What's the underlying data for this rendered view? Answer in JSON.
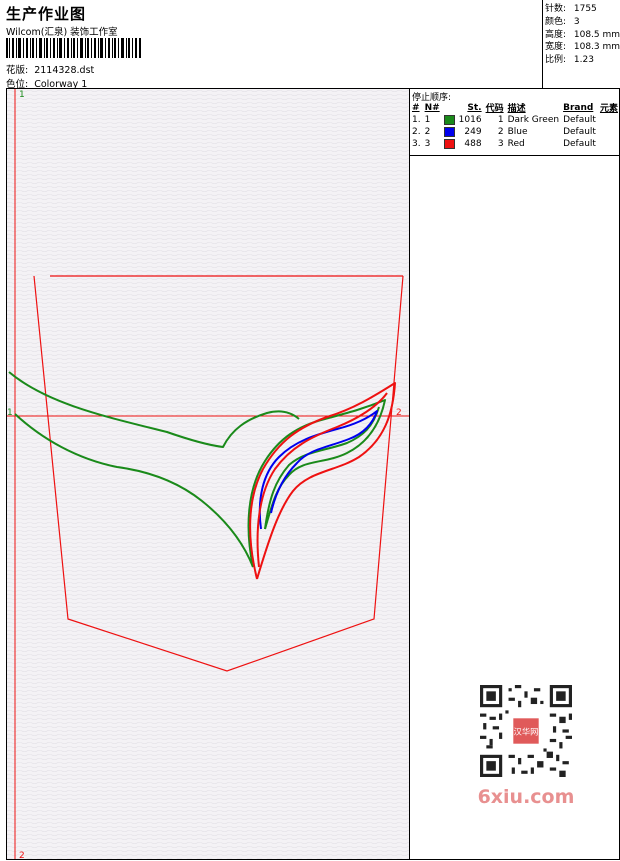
{
  "header": {
    "title": "生产作业图",
    "company": "Wilcom(汇泉) 装饰工作室",
    "design_label": "花版:",
    "design_value": "2114328.dst",
    "colorway_label": "色位:",
    "colorway_value": "Colorway 1"
  },
  "info": {
    "stitches_label": "针数:",
    "stitches": "1755",
    "colors_label": "颜色:",
    "colors": "3",
    "height_label": "高度:",
    "height": "108.5 mm",
    "width_label": "宽度:",
    "width": "108.3 mm",
    "scale_label": "比例:",
    "scale": "1.23"
  },
  "stop_sequence": {
    "title": "停止顺序:",
    "headers": [
      "#",
      "N#",
      "St.",
      "代码",
      "描述",
      "Brand",
      "元素"
    ],
    "rows": [
      {
        "idx": "1.",
        "n": "1",
        "color": "#1a8a1a",
        "st": "1016",
        "code": "1",
        "desc": "Dark Green",
        "brand": "Default"
      },
      {
        "idx": "2.",
        "n": "2",
        "color": "#0000ee",
        "st": "249",
        "code": "2",
        "desc": "Blue",
        "brand": "Default"
      },
      {
        "idx": "3.",
        "n": "3",
        "color": "#ee1111",
        "st": "488",
        "code": "3",
        "desc": "Red",
        "brand": "Default"
      }
    ]
  },
  "canvas": {
    "marker_1_top": "1",
    "marker_1_left": "1",
    "marker_2_right": "2",
    "marker_2_bottom": "2",
    "guide_color": "#ee1111",
    "green": "#1a8a1a",
    "blue": "#0000ee",
    "red": "#ee1111"
  },
  "watermark": {
    "text": "6xiu.com",
    "qr_badge": "汉华网"
  }
}
